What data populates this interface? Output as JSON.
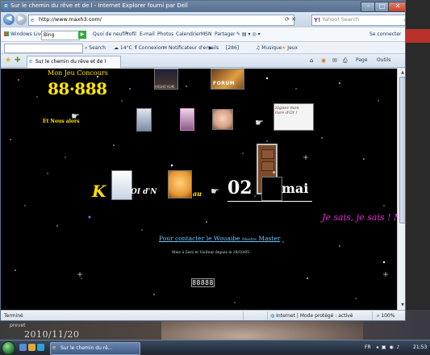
{
  "window": {
    "title": "Sur le chemin du rêve et de l - Internet Explorer fourni par Dell",
    "controls": {
      "minimize": "–",
      "maximize": "□",
      "close": "✕"
    }
  },
  "address_bar": {
    "url": "http://www.maxh3.com/",
    "search_placeholder": "Yahoo! Search",
    "search_logo": "Y!",
    "tools_glyphs": "⟳ ✕",
    "back_glyph": "◀",
    "forward_glyph": "▶"
  },
  "live_toolbar": {
    "brand": "Windows Live",
    "search_value": "Bing",
    "go": "▶",
    "links": [
      "Quoi de neuf ?",
      "Profil",
      "E-mail",
      "Photos",
      "Calendrier",
      "MSN",
      "Partager"
    ],
    "connect": "Se connecter"
  },
  "toolbar2": {
    "search": "Search",
    "weather": "14°C",
    "connexion": "Connexion",
    "notifications": "Notificateur d'emails",
    "count": "[286]",
    "music": "Musique",
    "games": "Jeux"
  },
  "favorites_bar": {
    "tab_title": "Sur le chemin du rêve et de l",
    "page_menu": "Page",
    "tools_menu": "Outils"
  },
  "page": {
    "concours_title": "Mon Jeu Concours",
    "concours_counter": "88·888",
    "et_nous": "Et Nous alors",
    "assho_label": "ASSHO KUKI",
    "forum_label": "FORUM",
    "livre_text": "Signez mon livre d'Or !",
    "koi_k": "K",
    "koi_oi": "OI d'N",
    "koi_au": "au",
    "koi_date": "02",
    "koi_mai": "mai",
    "je_sais": "Je sais, je sais ! Mon",
    "contact_main": "Pour contacter le Wouaibe",
    "contact_small": "Mestre",
    "contact_end": "Master",
    "visitors_text": "Mise à Zero et Visiteur depuis le 28/10/05",
    "visit_counter": "88888"
  },
  "status_bar": {
    "status": "Terminé",
    "zone": "Internet | Mode protégé : activé",
    "zoom": "100%"
  },
  "desktop": {
    "label": "prevet",
    "date_watermark": "2010/11/20"
  },
  "taskbar": {
    "task_title": "Sur le chemin du rê...",
    "lang": "FR",
    "clock": "21:53"
  }
}
